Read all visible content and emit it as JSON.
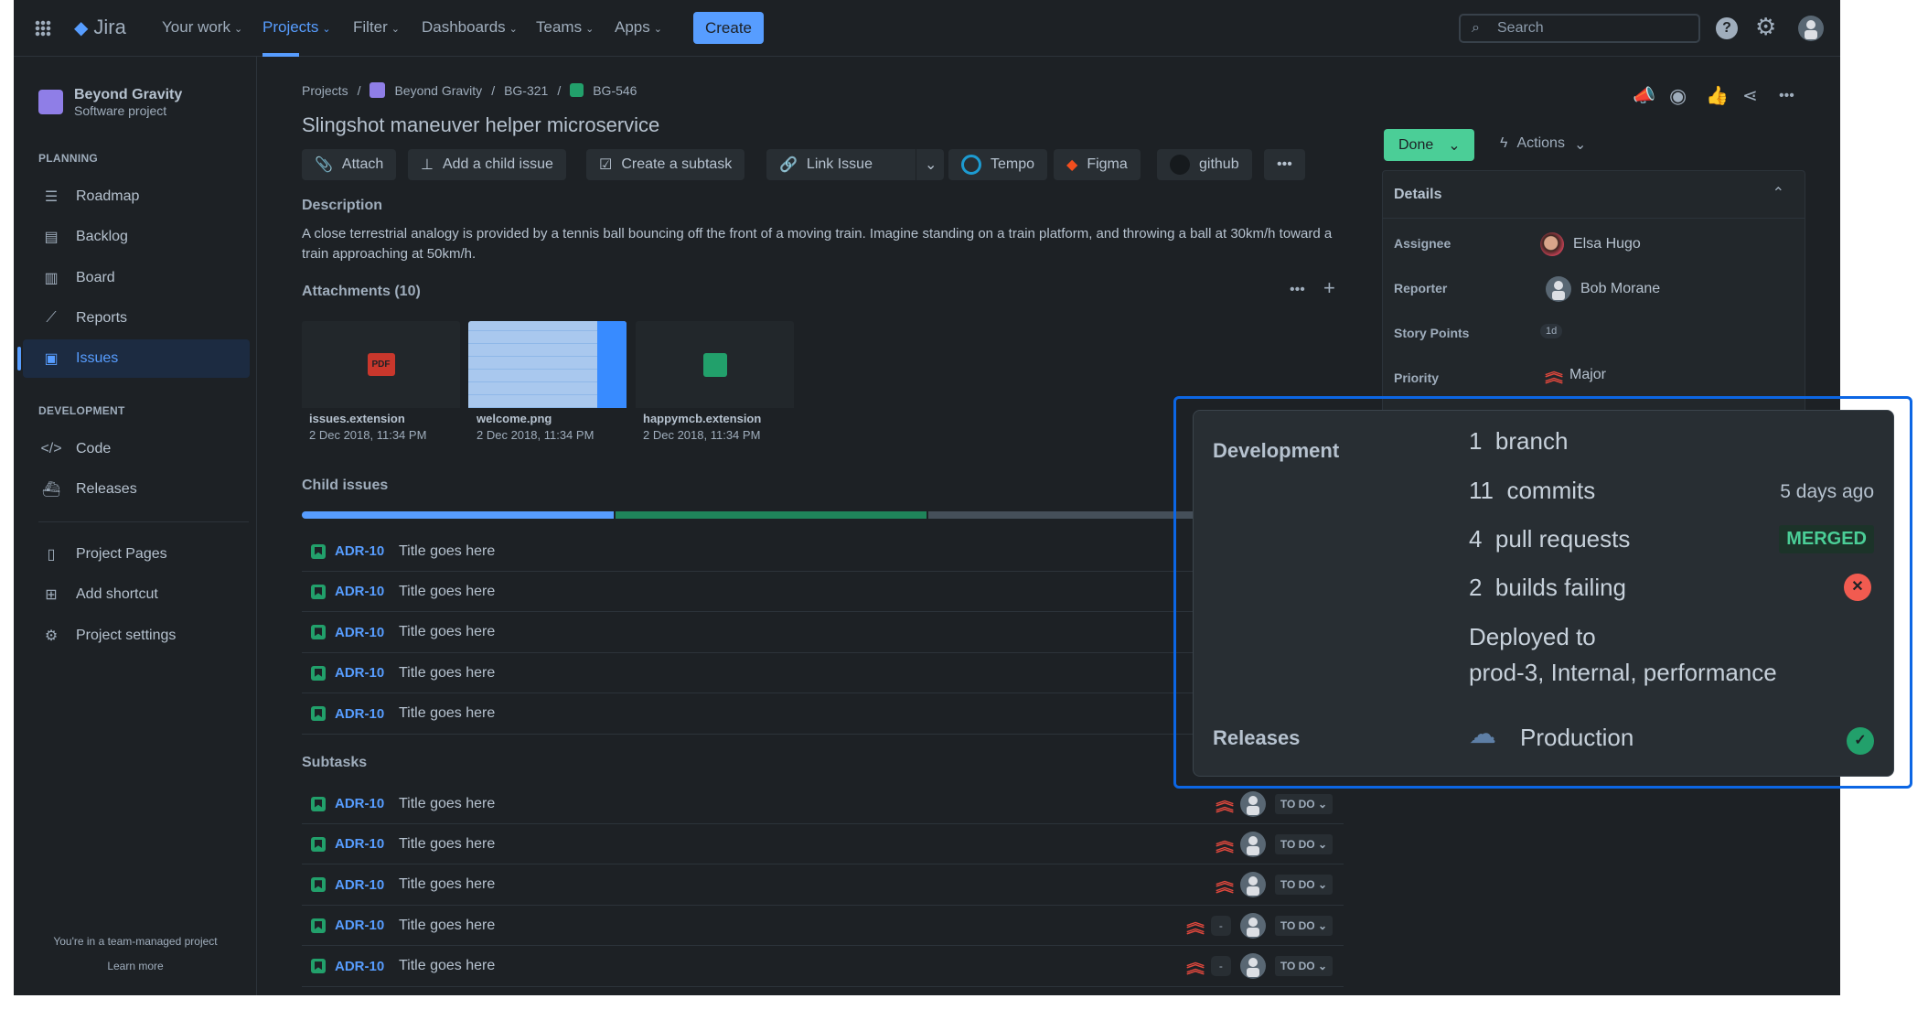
{
  "nav": {
    "app": "Jira",
    "items": [
      "Your work",
      "Projects",
      "Filter",
      "Dashboards",
      "Teams",
      "Apps"
    ],
    "create": "Create",
    "search_placeholder": "Search"
  },
  "sidebar": {
    "project_name": "Beyond Gravity",
    "project_type": "Software project",
    "planning": "PLANNING",
    "development": "DEVELOPMENT",
    "items": [
      "Roadmap",
      "Backlog",
      "Board",
      "Reports",
      "Issues",
      "Code",
      "Releases",
      "Project Pages",
      "Add shortcut",
      "Project settings"
    ],
    "footer": "You're in a team-managed project",
    "learn": "Learn more"
  },
  "breadcrumb": [
    "Projects",
    "Beyond Gravity",
    "BG-321",
    "BG-546"
  ],
  "title": "Slingshot maneuver helper microservice",
  "toolbar": [
    "Attach",
    "Add a child issue",
    "Create a subtask",
    "Link Issue",
    "Tempo",
    "Figma",
    "github"
  ],
  "description": {
    "label": "Description",
    "text": "A close terrestrial analogy is provided by a tennis ball bouncing off the front of a moving train. Imagine standing on a train platform, and throwing a ball at 30km/h toward a train approaching at 50km/h."
  },
  "attachments": {
    "label": "Attachments (10)",
    "files": [
      {
        "name": "issues.extension",
        "date": "2 Dec 2018, 11:34 PM"
      },
      {
        "name": "welcome.png",
        "date": "2 Dec 2018, 11:34 PM"
      },
      {
        "name": "happymcb.extension",
        "date": "2 Dec 2018, 11:34 PM"
      }
    ]
  },
  "child_issues": {
    "label": "Child issues",
    "progress": {
      "done": 0.3,
      "in_progress": 0.3,
      "todo": 0.4
    },
    "rows": [
      {
        "key": "ADR-10",
        "title": "Title goes here"
      },
      {
        "key": "ADR-10",
        "title": "Title goes here"
      },
      {
        "key": "ADR-10",
        "title": "Title goes here"
      },
      {
        "key": "ADR-10",
        "title": "Title goes here"
      },
      {
        "key": "ADR-10",
        "title": "Title goes here"
      }
    ]
  },
  "subtasks": {
    "label": "Subtasks",
    "rows": [
      {
        "key": "ADR-10",
        "title": "Title goes here",
        "status": "TO DO"
      },
      {
        "key": "ADR-10",
        "title": "Title goes here",
        "status": "TO DO"
      },
      {
        "key": "ADR-10",
        "title": "Title goes here",
        "status": "TO DO"
      },
      {
        "key": "ADR-10",
        "title": "Title goes here",
        "status": "TO DO",
        "est": "-"
      },
      {
        "key": "ADR-10",
        "title": "Title goes here",
        "status": "TO DO",
        "est": "-"
      }
    ]
  },
  "status": "Done",
  "actions": "Actions",
  "details": {
    "label": "Details",
    "assignee_label": "Assignee",
    "assignee": "Elsa Hugo",
    "reporter_label": "Reporter",
    "reporter": "Bob Morane",
    "sp_label": "Story Points",
    "sp": "1d",
    "priority_label": "Priority",
    "priority": "Major"
  },
  "popover": {
    "development": "Development",
    "branch_n": "1",
    "branch": "branch",
    "commits_n": "11",
    "commits": "commits",
    "commits_time": "5 days ago",
    "pr_n": "4",
    "pr": "pull requests",
    "pr_status": "MERGED",
    "builds_n": "2",
    "builds": "builds failing",
    "deployed": "Deployed to",
    "envs": "prod-3, Internal, performance",
    "releases": "Releases",
    "release": "Production"
  }
}
